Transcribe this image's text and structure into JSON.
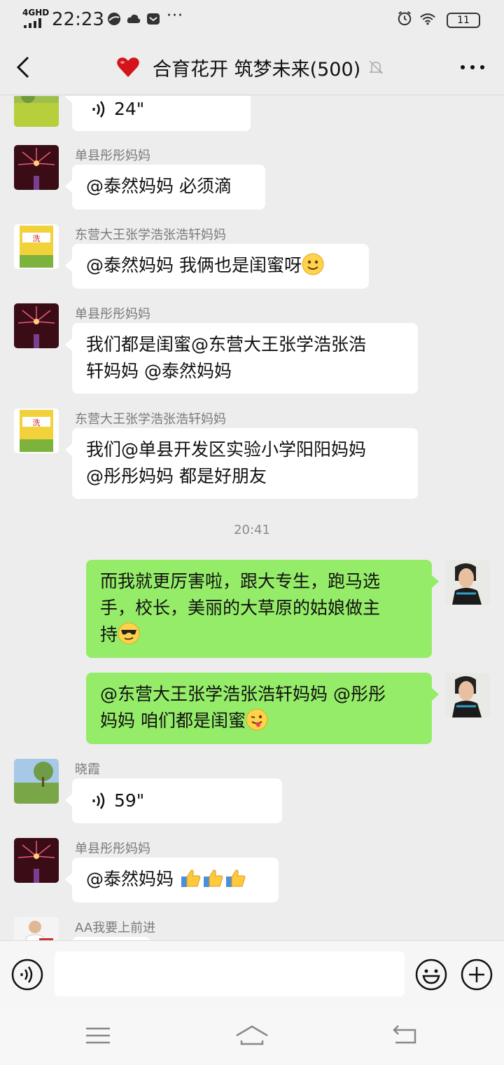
{
  "status_bar": {
    "network": "4GHD",
    "time": "22:23",
    "more": "···",
    "battery": "11"
  },
  "chat_header": {
    "title": "合育花开 筑梦未来(500)"
  },
  "messages": [
    {
      "sender": "",
      "voice_duration": "24\""
    },
    {
      "sender": "单县彤彤妈妈",
      "text": "@泰然妈妈  必须滴"
    },
    {
      "sender": "东营大王张学浩张浩轩妈妈",
      "text": "@泰然妈妈  我俩也是闺蜜呀",
      "emoji": "smile-emoji"
    },
    {
      "sender": "单县彤彤妈妈",
      "line1": "我们都是闺蜜@东营大王张学浩张浩",
      "line2": "轩妈妈  @泰然妈妈"
    },
    {
      "sender": "东营大王张学浩张浩轩妈妈",
      "line1": "我们@单县开发区实验小学阳阳妈妈",
      "line2": "@彤彤妈妈  都是好朋友"
    },
    {
      "timestamp": "20:41"
    },
    {
      "line1": "而我就更厉害啦，跟大专生，跑马选",
      "line2": "手，校长，美丽的大草原的姑娘做主",
      "line3": "持",
      "emoji": "sunglasses-emoji"
    },
    {
      "line1": "@东营大王张学浩张浩轩妈妈  @彤彤",
      "line2": "妈妈  咱们都是闺蜜",
      "emoji": "wink-tongue-emoji"
    },
    {
      "sender": "晓霞",
      "voice_duration": "59\""
    },
    {
      "sender": "单县彤彤妈妈",
      "text": "@泰然妈妈  ",
      "emoji": "thumbs-up-emoji"
    },
    {
      "sender": "AA我要上前进"
    }
  ],
  "input": {
    "placeholder": ""
  },
  "icons": {
    "voice": "voice-icon",
    "emoji": "emoji-icon",
    "plus": "plus-icon",
    "mute": "mute-bell-icon",
    "menu": "more-icon",
    "back": "back-arrow-icon"
  },
  "colors": {
    "background": "#ededed",
    "my_bubble": "#95ec69",
    "other_bubble": "#ffffff"
  }
}
